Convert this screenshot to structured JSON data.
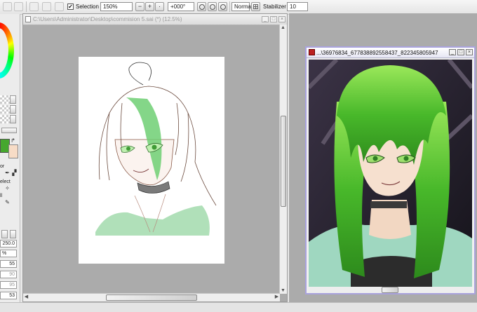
{
  "toolbar": {
    "selection_label": "Selection",
    "selection_checked": "✔",
    "zoom_value": "150%",
    "rotation_value": "+000°",
    "blend_mode": "Normal",
    "stabilizer_label": "Stabilizer",
    "stabilizer_value": "10"
  },
  "left_panel": {
    "tool_label_1": "or",
    "tool_label_2": "elect",
    "tool_label_3": "ll",
    "brush_size": "250.0",
    "percent_label": "%",
    "values": [
      "55",
      "90",
      "95",
      "53",
      "52"
    ]
  },
  "canvas_window": {
    "title": "C:\\Users\\Administrator\\Desktop\\commision 5.sai (*) (12.5%)",
    "minimize": "_",
    "maximize": "□",
    "close": "×"
  },
  "reference_window": {
    "title": "...\\36976834_677838892558437_822345805947",
    "minimize": "_",
    "maximize": "□",
    "close": "×"
  },
  "colors": {
    "foreground": "#46a72e",
    "background": "#f7dcc6",
    "accent_border": "#a9a2dd"
  }
}
